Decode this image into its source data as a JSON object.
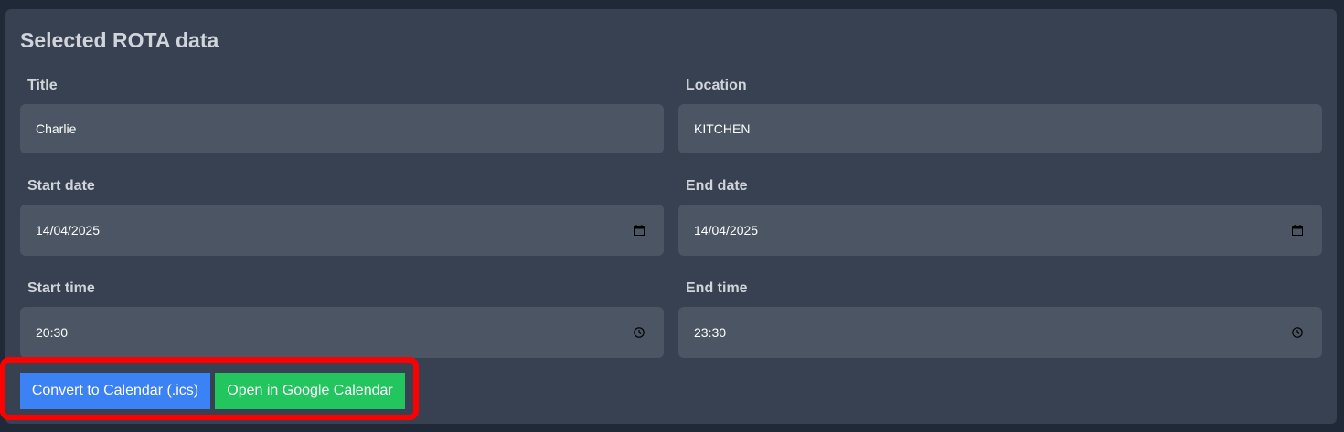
{
  "panel": {
    "title": "Selected ROTA data"
  },
  "fields": {
    "title": {
      "label": "Title",
      "value": "Charlie"
    },
    "location": {
      "label": "Location",
      "value": "KITCHEN"
    },
    "start_date": {
      "label": "Start date",
      "value": "14/04/2025",
      "icon": "calendar-icon"
    },
    "end_date": {
      "label": "End date",
      "value": "14/04/2025",
      "icon": "calendar-icon"
    },
    "start_time": {
      "label": "Start time",
      "value": "20:30",
      "icon": "clock-icon"
    },
    "end_time": {
      "label": "End time",
      "value": "23:30",
      "icon": "clock-icon"
    }
  },
  "actions": {
    "convert_label": "Convert to Calendar (.ics)",
    "google_label": "Open in Google Calendar"
  },
  "colors": {
    "page_bg": "#1f2937",
    "panel_bg": "#374151",
    "input_bg": "#4b5563",
    "convert_button": "#3b82f6",
    "google_button": "#22c55e",
    "highlight": "#ff0000"
  }
}
